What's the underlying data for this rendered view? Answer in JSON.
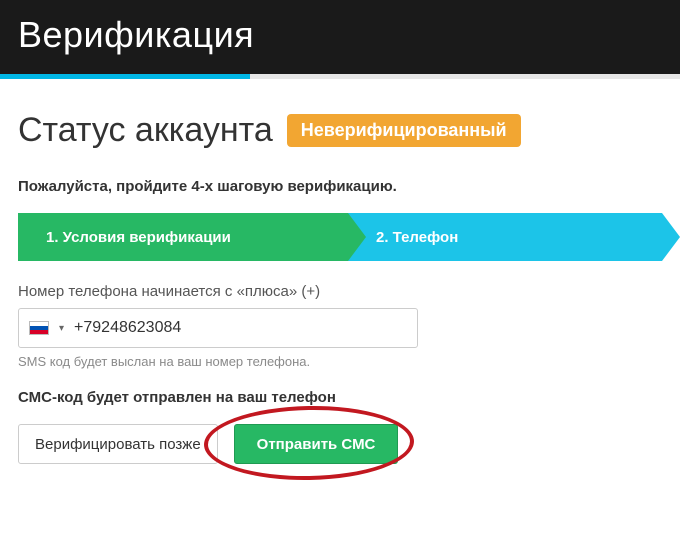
{
  "header": {
    "title": "Верификация"
  },
  "status": {
    "title": "Статус аккаунта",
    "badge": "Неверифицированный"
  },
  "instruction": "Пожалуйста, пройдите 4-х шаговую верификацию.",
  "steps": {
    "step1": "1. Условия верификации",
    "step2": "2. Телефон"
  },
  "phone": {
    "label": "Номер телефона начинается с «плюса» (+)",
    "value": "+79248623084",
    "hint": "SMS код будет выслан на ваш номер телефона.",
    "country": "ru"
  },
  "sms_note": "СМС-код будет отправлен на ваш телефон",
  "buttons": {
    "later": "Верифицировать позже",
    "send": "Отправить СМС"
  }
}
